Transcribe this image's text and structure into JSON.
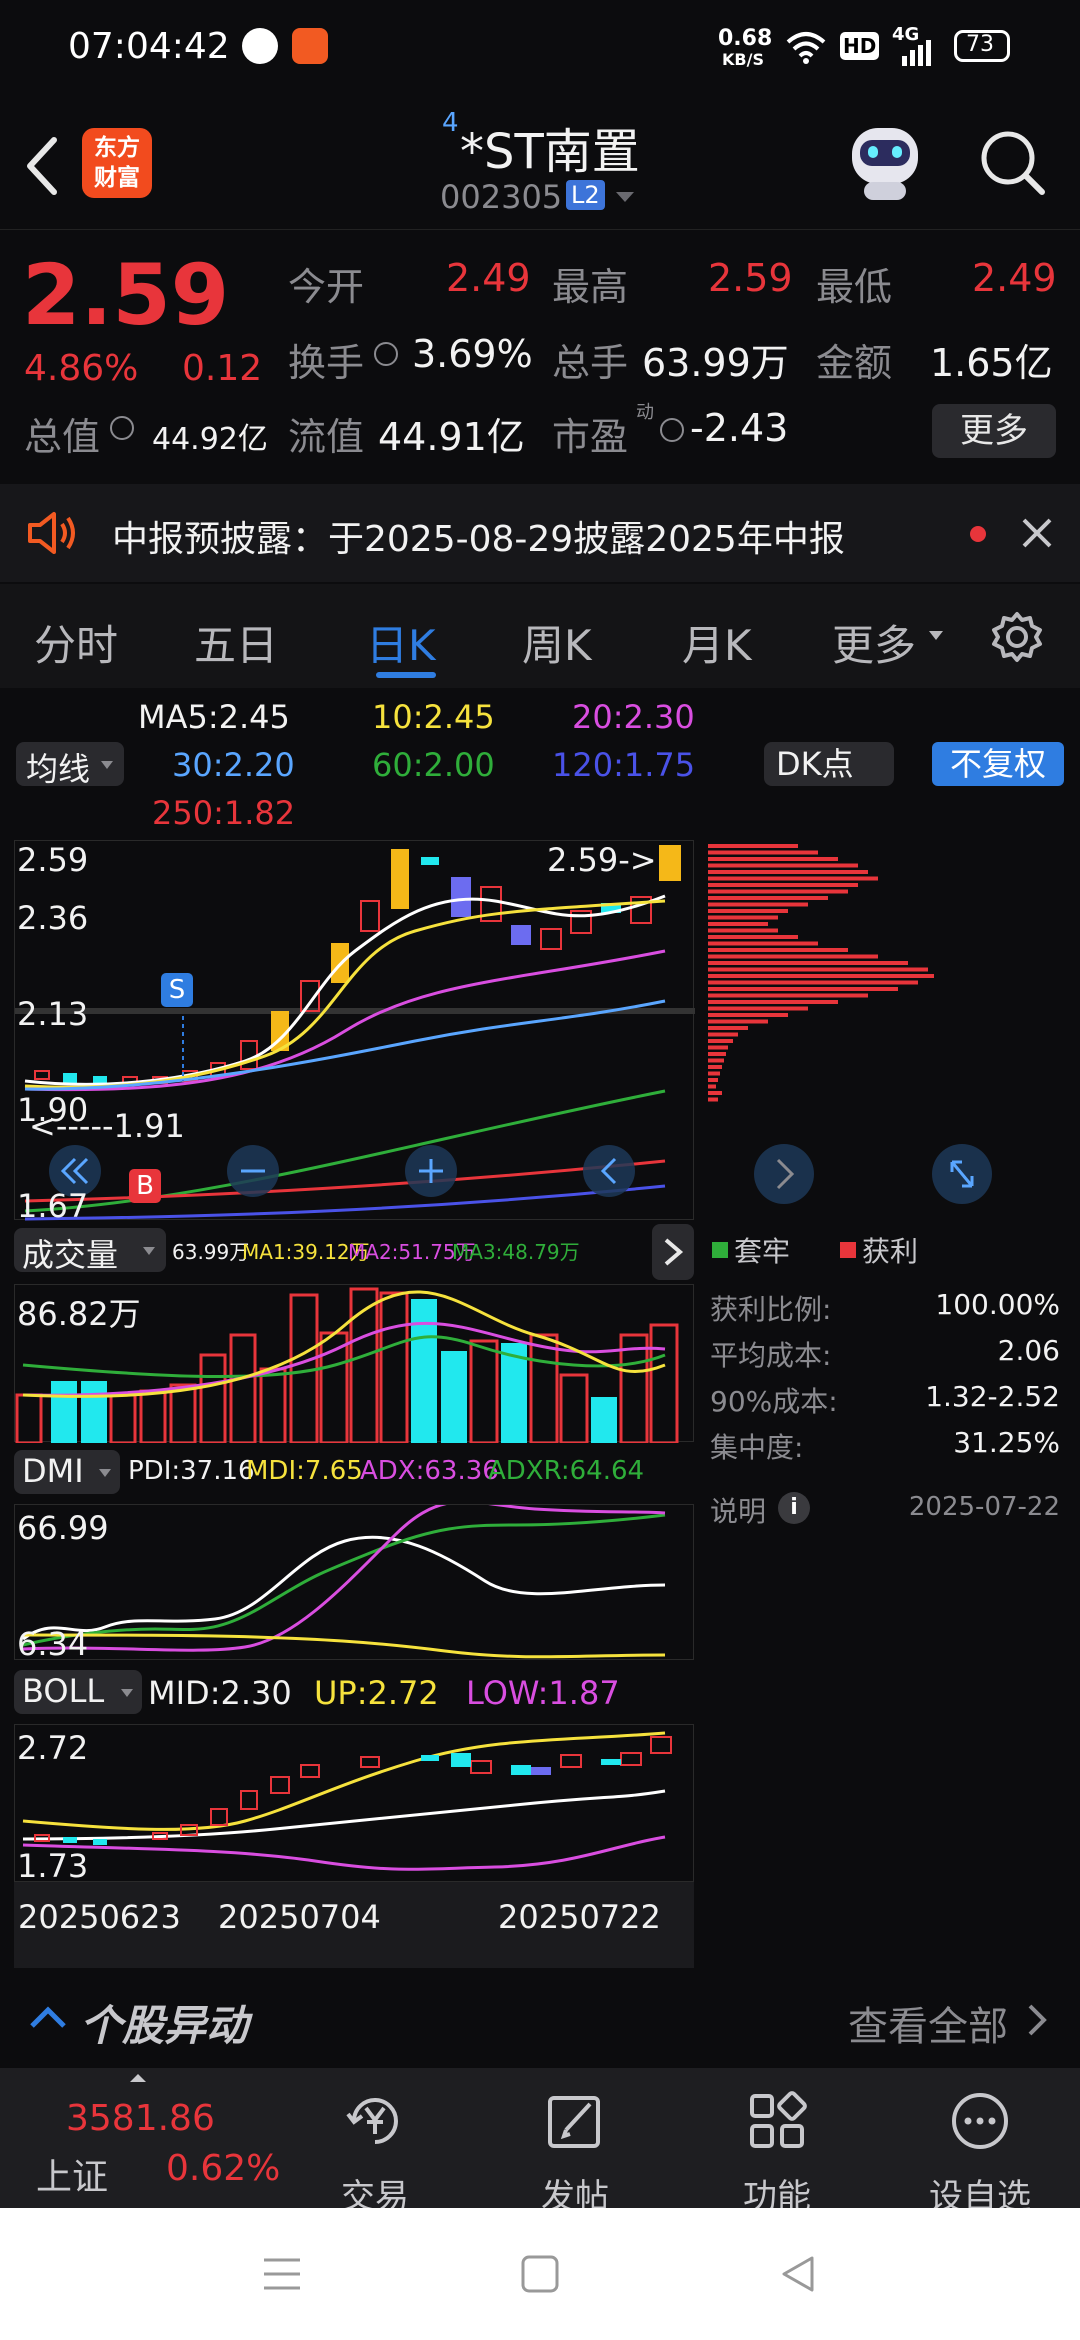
{
  "status_bar": {
    "time": "07:04:42",
    "speed_value": "0.68",
    "speed_unit": "KB/S",
    "hd": "HD",
    "network": "4G",
    "battery": "73"
  },
  "header": {
    "logo_line1": "东方",
    "logo_line2": "财富",
    "superscript": "4",
    "title": "*ST南置",
    "code": "002305",
    "level_badge": "L2"
  },
  "quote": {
    "price": "2.59",
    "change_pct": "4.86%",
    "change_amt": "0.12",
    "total_mv_label": "总值",
    "total_mv": "44.92亿",
    "open_label": "今开",
    "open": "2.49",
    "high_label": "最高",
    "high": "2.59",
    "low_label": "最低",
    "low": "2.49",
    "turnover_label": "换手",
    "turnover": "3.69%",
    "volume_label": "总手",
    "volume": "63.99万",
    "amount_label": "金额",
    "amount": "1.65亿",
    "float_mv_label": "流值",
    "float_mv": "44.91亿",
    "pe_label": "市盈",
    "pe_sup": "动",
    "pe": "-2.43",
    "more_button": "更多"
  },
  "notice": {
    "text": "中报预披露：于2025-08-29披露2025年中报"
  },
  "tabs": [
    "分时",
    "五日",
    "日K",
    "周K",
    "月K",
    "更多"
  ],
  "active_tab": 2,
  "ma_legend": {
    "selector": "均线",
    "ma5": "MA5:2.45",
    "ma10": "10:2.45",
    "ma20": "20:2.30",
    "ma30": "30:2.20",
    "ma60": "60:2.00",
    "ma120": "120:1.75",
    "ma250": "250:1.82",
    "dk_button": "DK点",
    "fq_button": "不复权"
  },
  "kline": {
    "y_top": "2.59",
    "y_2": "2.36",
    "y_3": "2.13",
    "y_4": "1.90",
    "y_bottom": "1.67",
    "last_price_tag": "2.59->",
    "low_tag": "<-----1.91",
    "s_mark": "S",
    "b_mark": "B"
  },
  "volume": {
    "selector": "成交量",
    "vol": "63.99万",
    "ma1": "MA1:39.12万",
    "ma2": "MA2:51.75万",
    "ma3": "MA3:48.79万",
    "y_top": "86.82万"
  },
  "dmi": {
    "selector": "DMI",
    "pdi": "PDI:37.16",
    "mdi": "MDI:7.65",
    "adx": "ADX:63.36",
    "adxr": "ADXR:64.64",
    "y_top": "66.99",
    "y_bottom": "6.34"
  },
  "boll": {
    "selector": "BOLL",
    "mid": "MID:2.30",
    "up": "UP:2.72",
    "low": "LOW:1.87",
    "y_top": "2.72",
    "y_bottom": "1.73"
  },
  "dates": [
    "20250623",
    "20250704",
    "20250722"
  ],
  "chip": {
    "legend_trapped": "套牢",
    "legend_profit": "获利",
    "rows": [
      {
        "label": "获利比例:",
        "value": "100.00%"
      },
      {
        "label": "平均成本:",
        "value": "2.06"
      },
      {
        "label": "90%成本:",
        "value": "1.32-2.52"
      },
      {
        "label": "集中度:",
        "value": "31.25%"
      }
    ],
    "note_label": "说明",
    "date": "2025-07-22"
  },
  "movement": {
    "title": "个股异动",
    "view_all": "查看全部"
  },
  "bottom_nav": {
    "index_value": "3581.86",
    "index_name": "上证",
    "index_change": "0.62%",
    "trade": "交易",
    "post": "发帖",
    "function": "功能",
    "watchlist": "设自选"
  },
  "colors": {
    "up_red": "#e8353b",
    "down_cyan": "#21e8ee",
    "accent_blue": "#2f7de1",
    "ma5_white": "#ffffff",
    "ma10_yellow": "#f6e23d",
    "ma20_pink": "#d94ee0",
    "ma30_blue": "#5aa6ff",
    "ma60_green": "#2fae3a",
    "ma120_navy": "#4a52e8"
  }
}
